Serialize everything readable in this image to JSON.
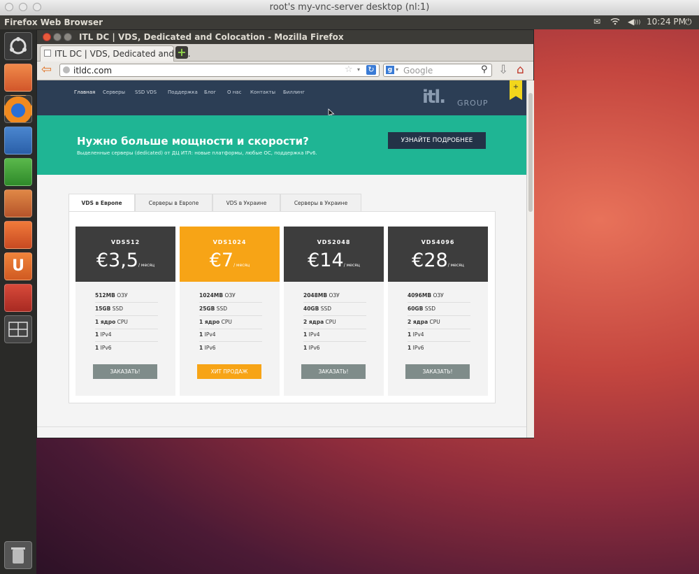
{
  "mac_window": {
    "title": "root's my-vnc-server desktop (nl:1)"
  },
  "panel": {
    "app_name": "Firefox Web Browser",
    "time": "10:24 PM"
  },
  "firefox": {
    "window_title": "ITL DC | VDS, Dedicated and Colocation - Mozilla Firefox",
    "tab_title": "ITL DC | VDS, Dedicated and C...",
    "url": "itldc.com",
    "search_placeholder": "Google"
  },
  "site": {
    "nav": [
      "Главная",
      "Серверы",
      "SSD VDS",
      "Поддержка",
      "Блог",
      "О нас",
      "Контакты",
      "Биллинг"
    ],
    "logo_text": "GROUP",
    "hero": {
      "heading": "Нужно больше мощности и скорости?",
      "subtext": "Выделенные серверы (dedicated) от ДЦ ИТЛ: новые платформы, любые ОС, поддержка IPv6.",
      "button": "УЗНАЙТЕ ПОДРОБНЕЕ"
    },
    "tabs": [
      "VDS в Европе",
      "Серверы в Европе",
      "VDS в Украине",
      "Серверы в Украине"
    ],
    "plans": [
      {
        "name": "VDS512",
        "price": "€3,5",
        "period": "/ месяц",
        "specs": [
          [
            "512MB",
            " ОЗУ"
          ],
          [
            "15GB",
            " SSD"
          ],
          [
            "1 ядро",
            " CPU"
          ],
          [
            "1",
            " IPv4"
          ],
          [
            "1",
            " IPv6"
          ]
        ],
        "button": "ЗАКАЗАТЬ!"
      },
      {
        "name": "VDS1024",
        "price": "€7",
        "period": "/ месяц",
        "specs": [
          [
            "1024MB",
            " ОЗУ"
          ],
          [
            "25GB",
            " SSD"
          ],
          [
            "1 ядро",
            " CPU"
          ],
          [
            "1",
            " IPv4"
          ],
          [
            "1",
            " IPv6"
          ]
        ],
        "button": "ХИТ ПРОДАЖ"
      },
      {
        "name": "VDS2048",
        "price": "€14",
        "period": "/ месяц",
        "specs": [
          [
            "2048MB",
            " ОЗУ"
          ],
          [
            "40GB",
            " SSD"
          ],
          [
            "2 ядра",
            " CPU"
          ],
          [
            "1",
            " IPv4"
          ],
          [
            "1",
            " IPv6"
          ]
        ],
        "button": "ЗАКАЗАТЬ!"
      },
      {
        "name": "VDS4096",
        "price": "€28",
        "period": "/ месяц",
        "specs": [
          [
            "4096MB",
            " ОЗУ"
          ],
          [
            "60GB",
            " SSD"
          ],
          [
            "2 ядра",
            " CPU"
          ],
          [
            "1",
            " IPv4"
          ],
          [
            "1",
            " IPv6"
          ]
        ],
        "button": "ЗАКАЗАТЬ!"
      }
    ]
  },
  "colors": {
    "header": "#2c3e55",
    "hero": "#1fb594",
    "featured": "#f7a416",
    "plan_dark": "#3d3d3d",
    "button_gray": "#7f8c8a"
  },
  "launcher_icons": [
    "ubuntu-dash-icon",
    "home-folder-icon",
    "firefox-icon",
    "writer-icon",
    "calc-icon",
    "impress-icon",
    "software-center-icon",
    "ubuntu-one-icon",
    "system-settings-icon",
    "workspace-switcher-icon",
    "trash-icon"
  ]
}
